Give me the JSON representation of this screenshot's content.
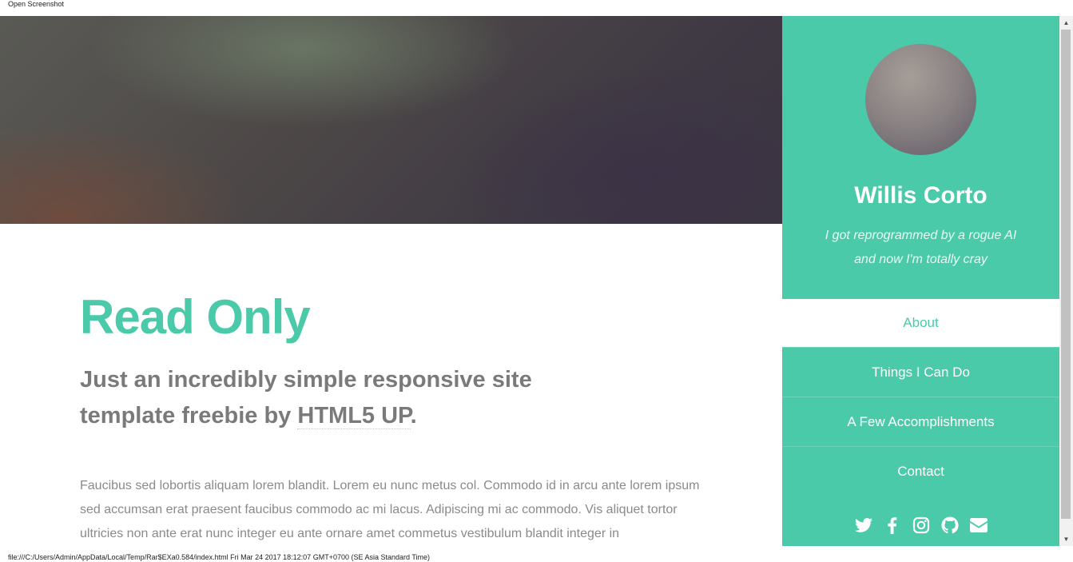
{
  "browser": {
    "top_label": "Open Screenshot",
    "status_text": "file:///C:/Users/Admin/AppData/Local/Temp/Rar$EXa0.584/index.html Fri Mar 24 2017 18:12:07 GMT+0700 (SE Asia Standard Time)"
  },
  "main": {
    "title": "Read Only",
    "subtitle_before": "Just an incredibly simple responsive site template freebie by ",
    "subtitle_link": "HTML5 UP",
    "subtitle_after": ".",
    "body": "Faucibus sed lobortis aliquam lorem blandit. Lorem eu nunc metus col. Commodo id in arcu ante lorem ipsum sed accumsan erat praesent faucibus commodo ac mi lacus. Adipiscing mi ac commodo. Vis aliquet tortor ultricies non ante erat nunc integer eu ante ornare amet commetus vestibulum blandit integer in"
  },
  "sidebar": {
    "name": "Willis Corto",
    "tagline_line1": "I got reprogrammed by a rogue AI",
    "tagline_line2": "and now I'm totally cray",
    "nav": [
      {
        "label": "About",
        "active": true
      },
      {
        "label": "Things I Can Do",
        "active": false
      },
      {
        "label": "A Few Accomplishments",
        "active": false
      },
      {
        "label": "Contact",
        "active": false
      }
    ],
    "socials": [
      "twitter-icon",
      "facebook-icon",
      "instagram-icon",
      "github-icon",
      "email-icon"
    ]
  },
  "colors": {
    "accent": "#4acaa8",
    "heading_gray": "#7a7a7a",
    "body_gray": "#8a8a8a"
  }
}
